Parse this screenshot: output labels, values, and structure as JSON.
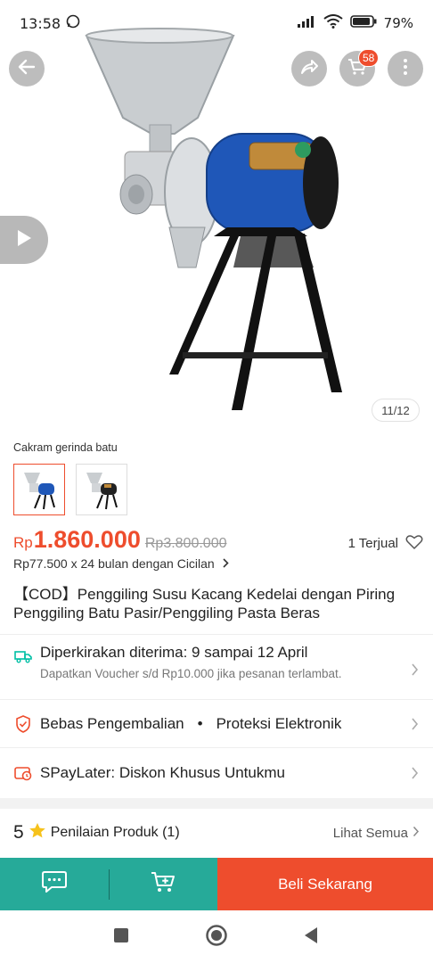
{
  "status_bar": {
    "time": "13:58",
    "battery": "79%"
  },
  "header": {
    "cart_badge": "58"
  },
  "gallery": {
    "counter": "11/12"
  },
  "variant": {
    "label": "Cakram gerinda batu"
  },
  "price": {
    "currency": "Rp",
    "current": "1.860.000",
    "original": "Rp3.800.000",
    "sold": "1 Terjual",
    "installment": "Rp77.500 x 24 bulan dengan Cicilan"
  },
  "product": {
    "title": "【COD】Penggiling Susu Kacang Kedelai dengan Piring Penggiling Batu Pasir/Penggiling Pasta Beras"
  },
  "shipping": {
    "estimate": "Diperkirakan diterima: 9 sampai 12 April",
    "voucher_note": "Dapatkan Voucher s/d Rp10.000 jika pesanan terlambat."
  },
  "guarantee": {
    "returns": "Bebas Pengembalian",
    "bullet": "•",
    "protection": "Proteksi Elektronik"
  },
  "paylater": {
    "label": "SPayLater: Diskon Khusus Untukmu"
  },
  "rating": {
    "score": "5",
    "label": "Penilaian Produk (1)",
    "see_all": "Lihat Semua"
  },
  "actions": {
    "buy_now": "Beli Sekarang"
  },
  "colors": {
    "accent": "#ee4d2d",
    "teal": "#26aa99",
    "teal_icon": "#00bfa5"
  },
  "icons": {
    "back": "arrow-left-icon",
    "share": "share-icon",
    "cart": "cart-icon",
    "more": "more-vertical-icon",
    "play": "play-icon",
    "heart": "heart-outline-icon",
    "truck": "truck-icon",
    "shield": "shield-check-icon",
    "paylater": "paylater-icon",
    "star": "star-icon",
    "chat": "chat-icon",
    "add_cart": "add-to-cart-icon"
  }
}
